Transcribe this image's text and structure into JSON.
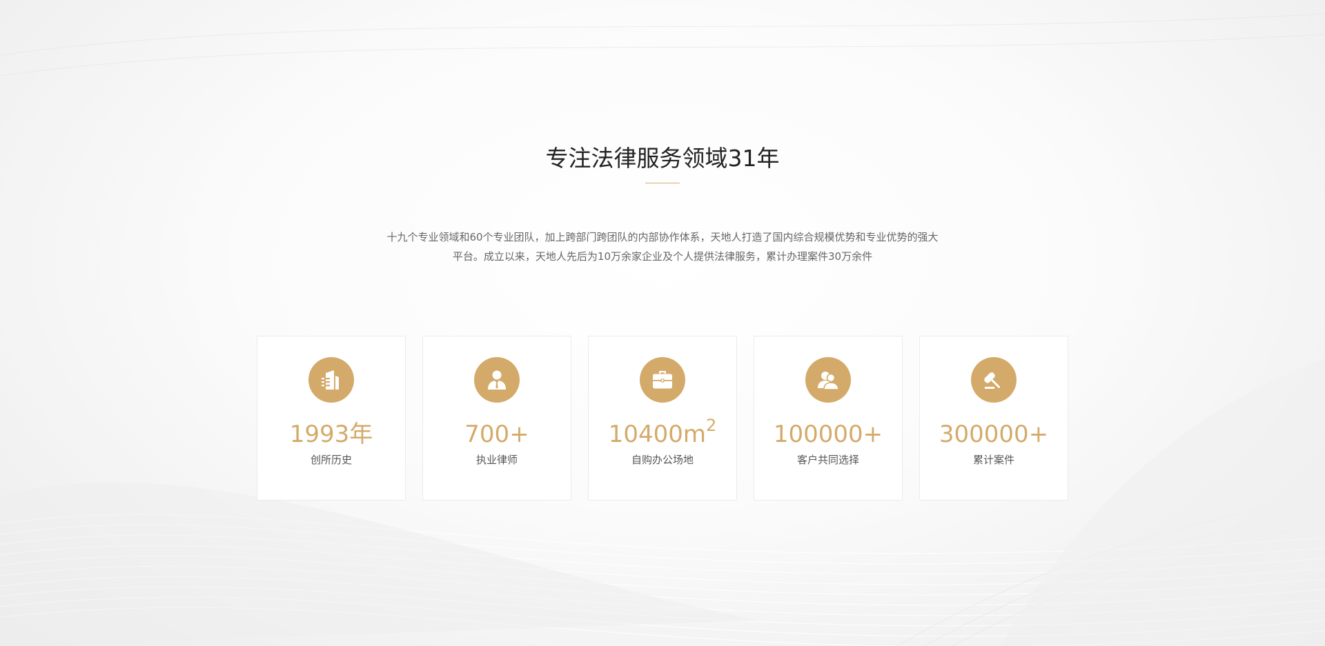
{
  "section": {
    "title": "专注法律服务领域31年",
    "description_line1": "十九个专业领域和60个专业团队，加上跨部门跨团队的内部协作体系，天地人打造了国内综合规模优势和专业优势的强大",
    "description_line2": "平台。成立以来，天地人先后为10万余家企业及个人提供法律服务，累计办理案件30万余件"
  },
  "stats": [
    {
      "icon": "building-icon",
      "value": "1993年",
      "label": "创所历史"
    },
    {
      "icon": "lawyer-icon",
      "value": "700+",
      "label": "执业律师"
    },
    {
      "icon": "briefcase-icon",
      "value": "10400m",
      "value_sup": "2",
      "label": "自购办公场地"
    },
    {
      "icon": "users-icon",
      "value": "100000+",
      "label": "客户共同选择"
    },
    {
      "icon": "gavel-icon",
      "value": "300000+",
      "label": "累计案件"
    }
  ],
  "colors": {
    "accent": "#d4aa6a",
    "title": "#222222",
    "text": "#666666"
  }
}
